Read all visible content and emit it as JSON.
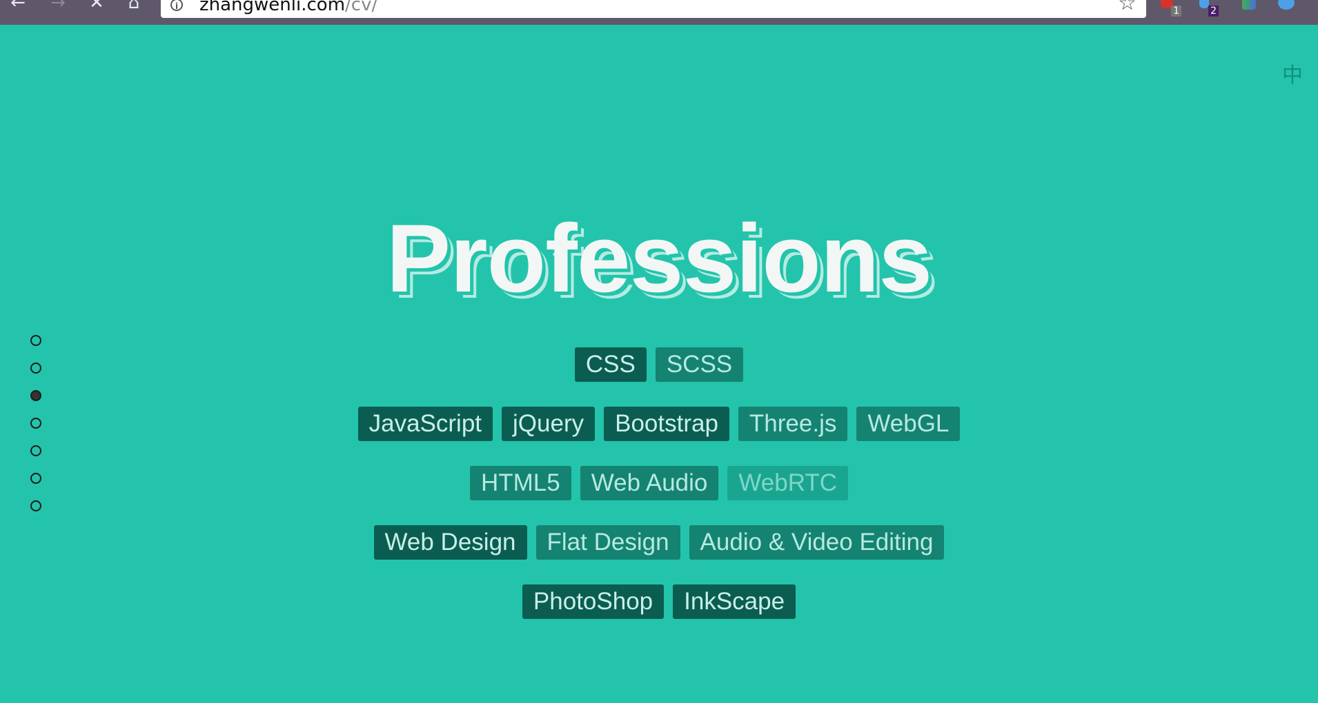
{
  "browser": {
    "url_host": "zhangwenli.com",
    "url_path": "/cv/",
    "info_icon": "i",
    "star_icon": "☆",
    "extensions": [
      {
        "icon": "adblock-icon",
        "badge": "1"
      },
      {
        "icon": "bell-icon",
        "badge": "2"
      },
      {
        "icon": "people-icon",
        "badge": ""
      },
      {
        "icon": "compass-icon",
        "badge": ""
      }
    ]
  },
  "page": {
    "lang_toggle": "中",
    "title": "Professions",
    "dot_count": 7,
    "active_dot": 3,
    "rows": [
      [
        {
          "label": "CSS",
          "level": "high"
        },
        {
          "label": "SCSS",
          "level": "mid"
        }
      ],
      [
        {
          "label": "JavaScript",
          "level": "high"
        },
        {
          "label": "jQuery",
          "level": "high"
        },
        {
          "label": "Bootstrap",
          "level": "high"
        },
        {
          "label": "Three.js",
          "level": "mid"
        },
        {
          "label": "WebGL",
          "level": "mid"
        }
      ],
      [
        {
          "label": "HTML5",
          "level": "mid"
        },
        {
          "label": "Web Audio",
          "level": "mid"
        },
        {
          "label": "WebRTC",
          "level": "low"
        }
      ],
      [
        {
          "label": "Web Design",
          "level": "high"
        },
        {
          "label": "Flat Design",
          "level": "mid"
        },
        {
          "label": "Audio & Video Editing",
          "level": "mid"
        }
      ],
      [
        {
          "label": "PhotoShop",
          "level": "high"
        },
        {
          "label": "InkScape",
          "level": "high"
        }
      ]
    ]
  },
  "colors": {
    "background": "#23c4ab",
    "tag_high": "#0b5d51",
    "tag_mid": "#148372",
    "tag_low": "#1aa591"
  }
}
